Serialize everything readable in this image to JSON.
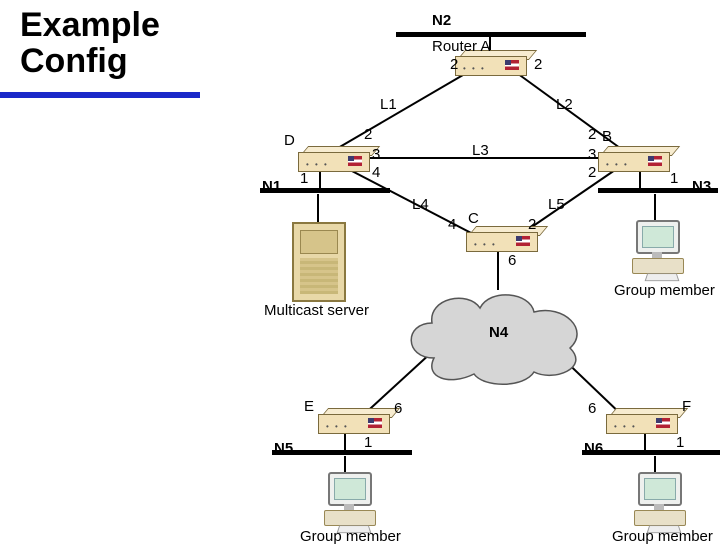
{
  "title_l1": "Example",
  "title_l2": "Config",
  "networks": {
    "n1": "N1",
    "n2": "N2",
    "n3": "N3",
    "n4": "N4",
    "n5": "N5",
    "n6": "N6"
  },
  "routers": {
    "a": "Router A",
    "b": "B",
    "c": "C",
    "d": "D",
    "e": "E",
    "f": "F"
  },
  "links": {
    "l1": "L1",
    "l2": "L2",
    "l3": "L3",
    "l4": "L4",
    "l5": "L5"
  },
  "costs": {
    "a_l1": "2",
    "a_l2": "2",
    "d_l1": "2",
    "d_l3": "3",
    "d_l4": "4",
    "d_n1": "1",
    "b_l2": "2",
    "b_l3": "3",
    "b_l5": "2",
    "b_n3": "1",
    "c_l4": "4",
    "c_l5": "2",
    "c_n4": "6",
    "e_n4": "6",
    "e_n5": "1",
    "f_n4": "6",
    "f_n6": "1"
  },
  "devices": {
    "mserver": "Multicast server",
    "gm": "Group member"
  }
}
